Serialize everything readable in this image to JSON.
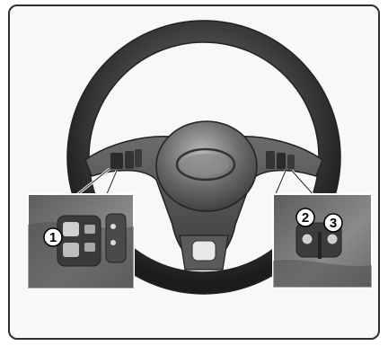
{
  "illustration": {
    "subject": "steering-wheel-with-audio-remote-controls",
    "callouts": [
      {
        "label": "1"
      },
      {
        "label": "2"
      },
      {
        "label": "3"
      }
    ]
  },
  "colors": {
    "frame_border": "#2f2f2f",
    "frame_background": "#f8f8f8",
    "wheel_rim": "#444444",
    "hub": "#6e6e6e",
    "inset_background": "#7a7a7a"
  }
}
